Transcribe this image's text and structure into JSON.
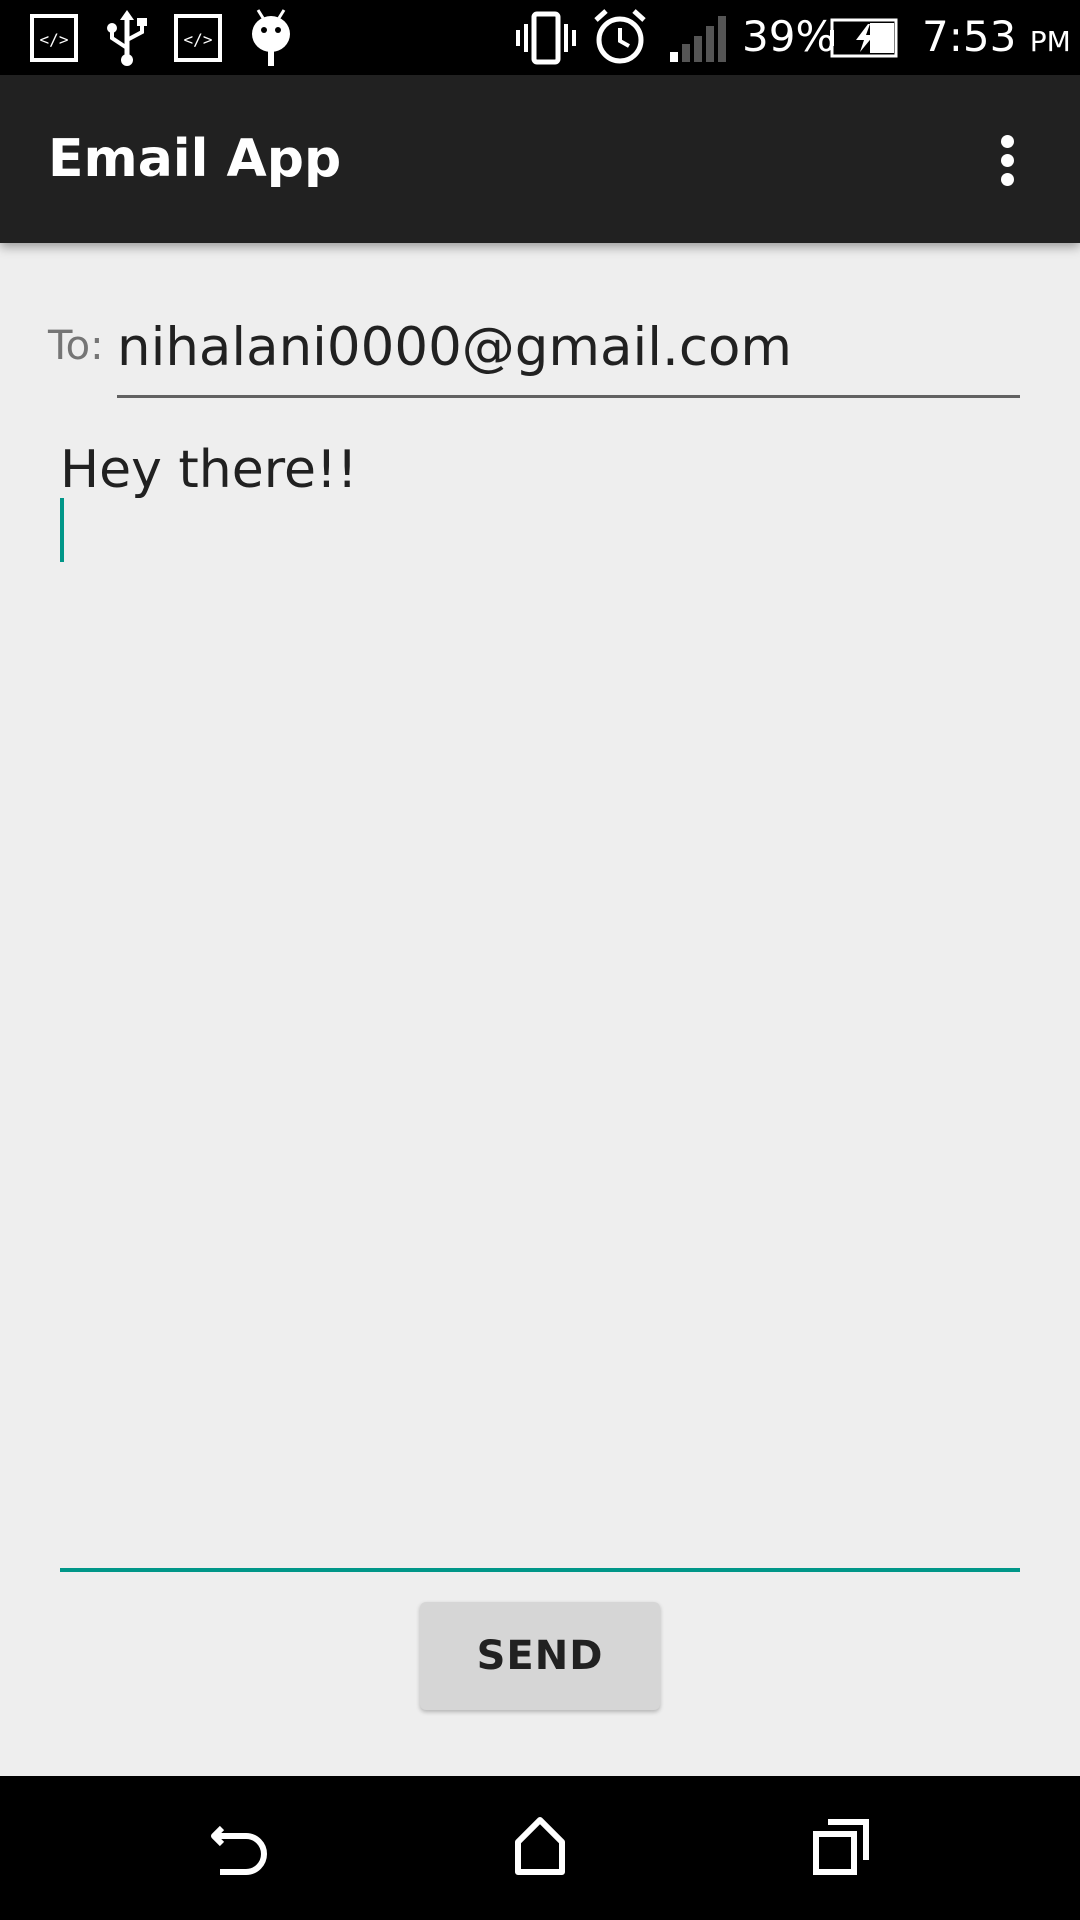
{
  "status_bar": {
    "battery": "39%",
    "time": "7:53",
    "ampm": "PM",
    "icons": [
      "code-icon",
      "usb-icon",
      "code-icon",
      "android-debug-icon",
      "vibrate-icon",
      "alarm-icon",
      "signal-icon",
      "battery-charging-icon"
    ]
  },
  "app_bar": {
    "title": "Email App",
    "overflow_icon": "more-vert-icon"
  },
  "compose": {
    "to_label": "To:",
    "to_value": "nihalani0000@gmail.com",
    "body_text": "Hey there!!"
  },
  "actions": {
    "send_label": "SEND"
  },
  "nav_bar": {
    "icons": [
      "back-icon",
      "home-icon",
      "recents-icon"
    ]
  },
  "colors": {
    "accent": "#009688",
    "app_bar": "#212121",
    "background": "#eeeeee"
  }
}
